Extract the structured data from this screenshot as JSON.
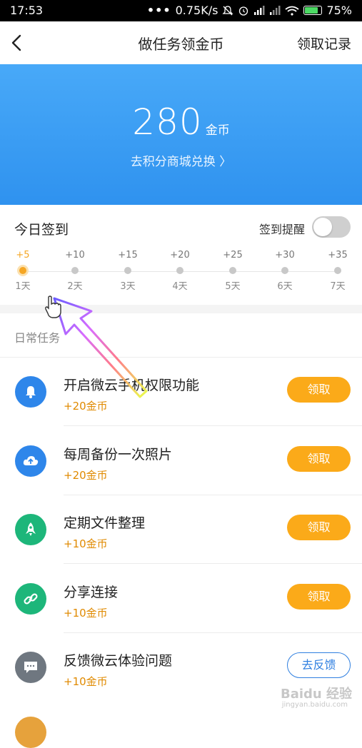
{
  "status_bar": {
    "time": "17:53",
    "dots": "•••",
    "speed": "0.75K/s",
    "battery": "75%"
  },
  "nav": {
    "title": "做任务领金币",
    "right_link": "领取记录"
  },
  "hero": {
    "coins": "280",
    "coin_unit": "金币",
    "redeem_link": "去积分商城兑换 〉"
  },
  "checkin": {
    "title": "今日签到",
    "reminder_label": "签到提醒",
    "reminder_on": false,
    "days": [
      {
        "points": "+5",
        "label": "1天",
        "active": true
      },
      {
        "points": "+10",
        "label": "2天",
        "active": false
      },
      {
        "points": "+15",
        "label": "3天",
        "active": false
      },
      {
        "points": "+20",
        "label": "4天",
        "active": false
      },
      {
        "points": "+25",
        "label": "5天",
        "active": false
      },
      {
        "points": "+30",
        "label": "6天",
        "active": false
      },
      {
        "points": "+35",
        "label": "7天",
        "active": false
      }
    ]
  },
  "daily": {
    "title": "日常任务",
    "tasks": [
      {
        "name": "开启微云手机权限功能",
        "reward": "+20金币",
        "button": "领取",
        "icon": "bell-icon",
        "color": "#2e86ea"
      },
      {
        "name": "每周备份一次照片",
        "reward": "+20金币",
        "button": "领取",
        "icon": "cloud-upload-icon",
        "color": "#2e86ea"
      },
      {
        "name": "定期文件整理",
        "reward": "+10金币",
        "button": "领取",
        "icon": "rocket-icon",
        "color": "#1db67a"
      },
      {
        "name": "分享连接",
        "reward": "+10金币",
        "button": "领取",
        "icon": "link-icon",
        "color": "#1db67a"
      },
      {
        "name": "反馈微云体验问题",
        "reward": "+10金币",
        "button": "去反馈",
        "icon": "message-icon",
        "color": "#6f7780"
      }
    ]
  },
  "watermark": {
    "main": "Baidu 经验",
    "sub": "jingyan.baidu.com"
  },
  "colors": {
    "accent": "#2f92ef",
    "orange": "#fbaa19",
    "green": "#1db67a"
  }
}
